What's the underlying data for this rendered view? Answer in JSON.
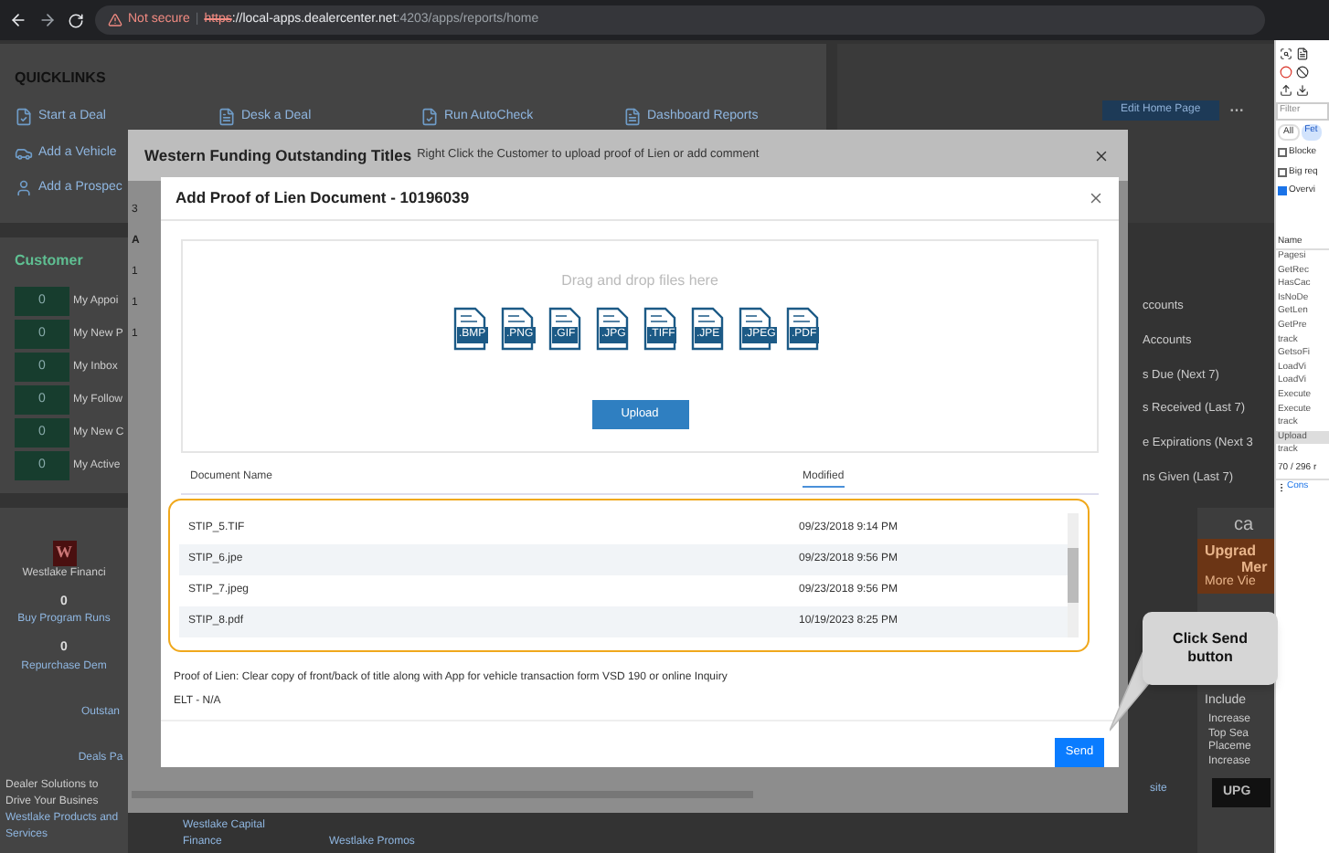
{
  "browser": {
    "warning": "Not secure",
    "separator": "|",
    "url_scheme": "https",
    "url_host": "://local-apps.dealercenter.net",
    "url_path": ":4203/apps/reports/home"
  },
  "quicklinks": {
    "title": "QUICKLINKS",
    "rows": [
      {
        "links": [
          "Start a Deal",
          "Desk a Deal",
          "Run AutoCheck",
          "Dashboard Reports"
        ]
      },
      {
        "links": [
          "Add a Vehicle"
        ]
      },
      {
        "links": [
          "Add a Prospec"
        ]
      }
    ],
    "edit_button": "Edit Home Page",
    "more": "···"
  },
  "customer": {
    "title": "Customer",
    "counters": [
      {
        "count": "0",
        "label": "My Appoi"
      },
      {
        "count": "0",
        "label": "My New P"
      },
      {
        "count": "0",
        "label": "My Inbox"
      },
      {
        "count": "0",
        "label": "My Follow"
      },
      {
        "count": "0",
        "label": "My New C"
      },
      {
        "count": "0",
        "label": "My Active"
      }
    ]
  },
  "right_list": [
    "ccounts",
    "Accounts",
    "s Due (Next 7)",
    "s Received (Last 7)",
    "e Expirations (Next 3",
    "ns Given (Last 7)"
  ],
  "westlake": {
    "logo": "W",
    "name": "Westlake Financi",
    "stats": [
      {
        "count": "0",
        "label": "Buy Program Runs"
      },
      {
        "count": "0",
        "label": "Repurchase Dem"
      }
    ],
    "links": [
      "Outstan",
      "Deals Pa"
    ],
    "promo": "Dealer Solutions to Drive Your Busines",
    "promo_link": "Westlake Products and Services"
  },
  "bottom_links": [
    "Westlake Capital Finance",
    "Westlake Promos"
  ],
  "ad": {
    "brand": "ca",
    "headline": "Upgrad",
    "line_2": "Mer",
    "line_3": "More Vie",
    "include": "Include",
    "bullets": [
      "Increase",
      "Top Sea Placeme",
      "Increase"
    ],
    "button": "UPG",
    "footer_link": "site"
  },
  "devtools": {
    "filter": "Filter",
    "chips": [
      {
        "label": "All",
        "selected": false
      },
      {
        "label": "Fet",
        "selected": true
      }
    ],
    "options": [
      {
        "label": "Blocke",
        "checked": false
      },
      {
        "label": "Big req",
        "checked": false
      },
      {
        "label": "Overvi",
        "checked": true
      }
    ],
    "name_header": "Name",
    "requests": [
      {
        "name": "Pagesi",
        "selected": false
      },
      {
        "name": "GetRec",
        "selected": false
      },
      {
        "name": "HasCac",
        "selected": false
      },
      {
        "name": "IsNoDe",
        "selected": false
      },
      {
        "name": "GetLen",
        "selected": false
      },
      {
        "name": "GetPre",
        "selected": false
      },
      {
        "name": "track",
        "selected": false
      },
      {
        "name": "GetsoFi",
        "selected": false
      },
      {
        "name": "LoadVi",
        "selected": false
      },
      {
        "name": "LoadVi",
        "selected": false
      },
      {
        "name": "Execute",
        "selected": false
      },
      {
        "name": "Execute",
        "selected": false
      },
      {
        "name": "track",
        "selected": false
      },
      {
        "name": "Upload",
        "selected": true
      },
      {
        "name": "track",
        "selected": false
      }
    ],
    "summary": "70 / 296 r",
    "console_tab": "Cons"
  },
  "outer_modal": {
    "title": "Western Funding Outstanding Titles",
    "subtitle": "Right Click the Customer to upload proof of Lien or add comment",
    "count": "3",
    "column_1": "A",
    "rows": [
      "1",
      "1",
      "1"
    ]
  },
  "modal": {
    "title": "Add Proof of Lien Document - 10196039",
    "dropzone": "Drag and drop files here",
    "file_types": [
      ".BMP",
      ".PNG",
      ".GIF",
      ".JPG",
      ".TIFF",
      ".JPE",
      ".JPEG",
      ".PDF"
    ],
    "upload_button": "Upload",
    "columns": [
      "Document Name",
      "Modified"
    ],
    "documents": [
      {
        "name": "STIP_5.TIF",
        "modified": "09/23/2018 9:14 PM"
      },
      {
        "name": "STIP_6.jpe",
        "modified": "09/23/2018 9:56 PM"
      },
      {
        "name": "STIP_7.jpeg",
        "modified": "09/23/2018 9:56 PM"
      },
      {
        "name": "STIP_8.pdf",
        "modified": "10/19/2023 8:25 PM"
      }
    ],
    "note": "Proof of Lien: Clear copy of front/back of title along with App for vehicle transaction form VSD 190 or online Inquiry",
    "elt": "ELT - N/A",
    "send_button": "Send"
  },
  "callout": "Click Send button"
}
